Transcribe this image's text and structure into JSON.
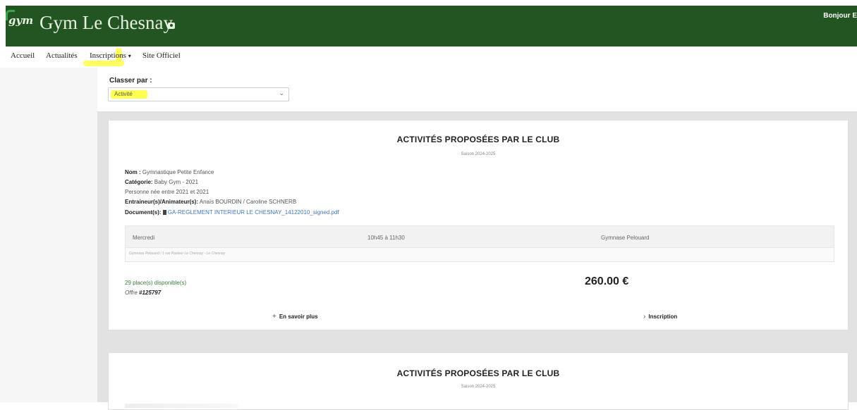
{
  "header": {
    "logo_text": "gym",
    "site_title": "Gym Le Chesnay",
    "title_icon": "camera-icon",
    "greeting": "Bonjour E"
  },
  "nav": {
    "items": [
      {
        "label": "Accueil"
      },
      {
        "label": "Actualités"
      },
      {
        "label": "Inscriptions",
        "caret": "▾"
      },
      {
        "label": "Site Officiel"
      }
    ],
    "highlight_color": "#ffff4d"
  },
  "filter": {
    "label": "Classer par :",
    "selected": "Activité",
    "chevron": "⌄"
  },
  "colors": {
    "header_bg": "#225522",
    "accent_green": "#3aa64a",
    "link": "#3a78c8",
    "content_bg": "#e2e2e2"
  },
  "card1": {
    "title": "ACTIVITÉS PROPOSÉES PAR LE CLUB",
    "season": "Saison 2024-2025",
    "name_label": "Nom :",
    "name_value": "Gymnastique Petite Enfance",
    "category_label": "Catégorie:",
    "category_value": "Baby Gym - 2021",
    "born": "Personne née entre 2021 et 2021",
    "trainers_label": "Entraineur(s)/Animateur(s):",
    "trainers_value": "Anaïs BOURDIN / Caroline SCHNERB",
    "docs_label": "Document(s):",
    "doc_link": "GA-REGLEMENT INTERIEUR LE CHESNAY_14122010_signed.pdf",
    "schedule": {
      "day": "Mercredi",
      "time": "10h45 à 11h30",
      "place": "Gymnase Pelouard",
      "address": "Gymnase Pelouard / 1 rue Pasteur Le Chesnay - Le Chesnay"
    },
    "places": "29 place(s) disponible(s)",
    "offer_label": "Offre",
    "offer_number": "#125797",
    "price": "260.00 €",
    "more_icon": "+",
    "more_label": "En savoir plus",
    "signup_icon": "›",
    "signup_label": "Inscription"
  },
  "card2": {
    "title": "ACTIVITÉS PROPOSÉES PAR LE CLUB",
    "season": "Saison 2024-2025"
  }
}
